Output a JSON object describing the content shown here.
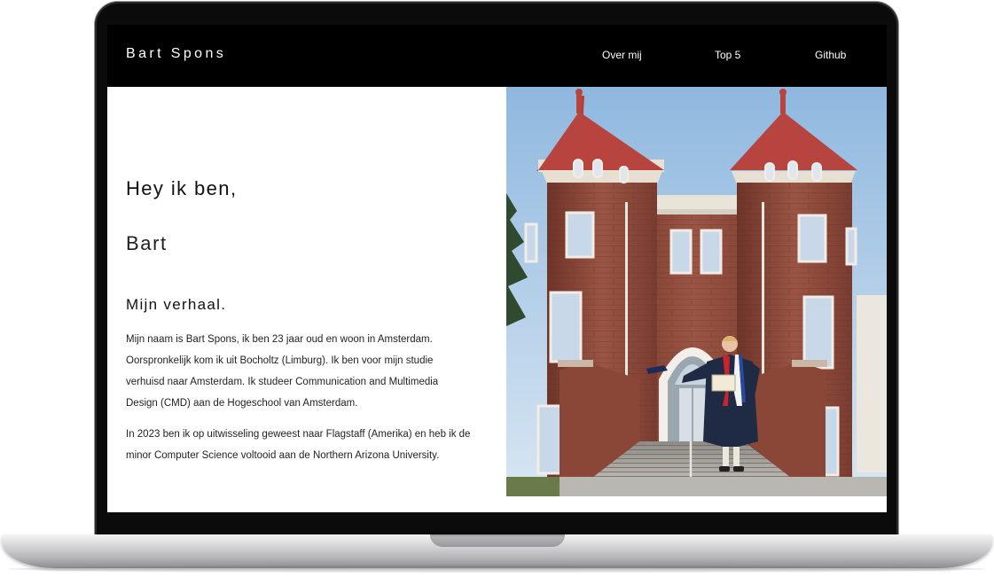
{
  "site": {
    "brand": "Bart Spons",
    "nav": [
      {
        "label": "Over mij"
      },
      {
        "label": "Top 5"
      },
      {
        "label": "Github"
      }
    ]
  },
  "hero": {
    "greeting": "Hey ik ben,",
    "name": "Bart"
  },
  "story": {
    "title": "Mijn verhaal.",
    "paragraphs": [
      "Mijn naam is Bart Spons, ik ben 23 jaar oud en woon in Amsterdam. Oorspronkelijk kom ik uit Bocholtz (Limburg). Ik ben voor mijn studie verhuisd naar Amsterdam. Ik studeer Communication and Multimedia Design (CMD) aan de Hogeschool van Amsterdam.",
      "In 2023 ben ik op uitwisseling geweest naar Flagstaff (Amerika) en heb ik de minor Computer Science voltooid aan de Northern Arizona University."
    ]
  },
  "colors": {
    "nav_bg": "#000000",
    "nav_text": "#ffffff",
    "body_text": "#222222",
    "brick": "#8e4a3a",
    "roof": "#b43d3a",
    "sky": "#a9c9e6"
  }
}
